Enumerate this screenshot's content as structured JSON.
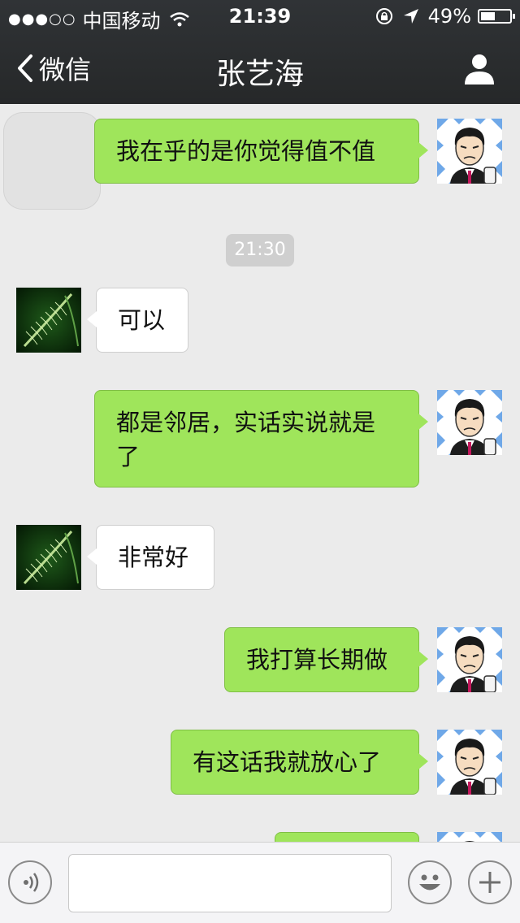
{
  "status_bar": {
    "signal": "●●●○○",
    "carrier": "中国移动",
    "time": "21:39",
    "battery": "49%",
    "battery_level": 0.49
  },
  "nav": {
    "back_label": "微信",
    "title": "张艺海"
  },
  "messages": [
    {
      "side": "me",
      "text": "我在乎的是你觉得值不值"
    },
    {
      "side": "time",
      "text": "21:30"
    },
    {
      "side": "them",
      "text": "可以"
    },
    {
      "side": "me",
      "line1": "都是邻居，实话实说就是",
      "line2": "了"
    },
    {
      "side": "them",
      "text": "非常好"
    },
    {
      "side": "me",
      "text": "我打算长期做"
    },
    {
      "side": "me",
      "text": "有这话我就放心了"
    }
  ],
  "colors": {
    "my_bubble": "#9fe55b",
    "their_bubble": "#ffffff",
    "header": "#2b2d2f",
    "background": "#ebebeb"
  },
  "icons": {
    "voice": "voice-icon",
    "emoji": "emoji-icon",
    "plus": "plus-icon",
    "back": "chevron-left-icon",
    "profile": "profile-icon"
  }
}
